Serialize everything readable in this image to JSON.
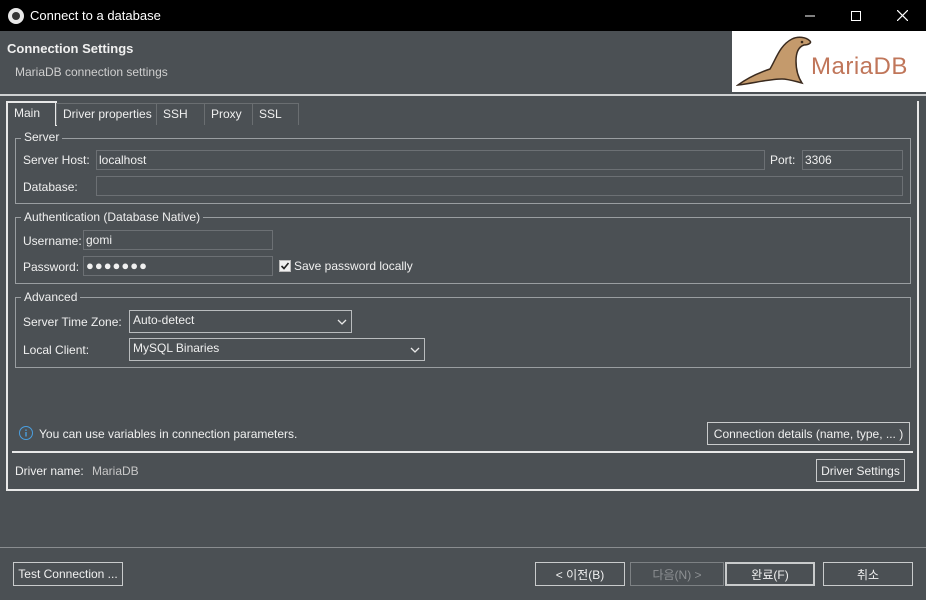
{
  "window": {
    "title": "Connect to a database"
  },
  "header": {
    "title": "Connection Settings",
    "subtitle": "MariaDB connection settings",
    "logo_text": "MariaDB"
  },
  "tabs": [
    "Main",
    "Driver properties",
    "SSH",
    "Proxy",
    "SSL"
  ],
  "server": {
    "group_label": "Server",
    "host_label": "Server Host:",
    "host_value": "localhost",
    "port_label": "Port:",
    "port_value": "3306",
    "database_label": "Database:",
    "database_value": ""
  },
  "auth": {
    "group_label": "Authentication (Database Native)",
    "username_label": "Username:",
    "username_value": "gomi",
    "password_label": "Password:",
    "password_mask": "●●●●●●●",
    "save_password_label": "Save password locally",
    "save_password_checked": true
  },
  "advanced": {
    "group_label": "Advanced",
    "timezone_label": "Server Time Zone:",
    "timezone_value": "Auto-detect",
    "local_client_label": "Local Client:",
    "local_client_value": "MySQL Binaries"
  },
  "info_text": "You can use variables in connection parameters.",
  "connection_details_label": "Connection details (name, type, ... )",
  "driver": {
    "name_label": "Driver name:",
    "name_value": "MariaDB",
    "settings_label": "Driver Settings"
  },
  "footer": {
    "test_label": "Test Connection ...",
    "back_label": "< 이전(B)",
    "next_label": "다음(N) >",
    "finish_label": "완료(F)",
    "cancel_label": "취소"
  }
}
